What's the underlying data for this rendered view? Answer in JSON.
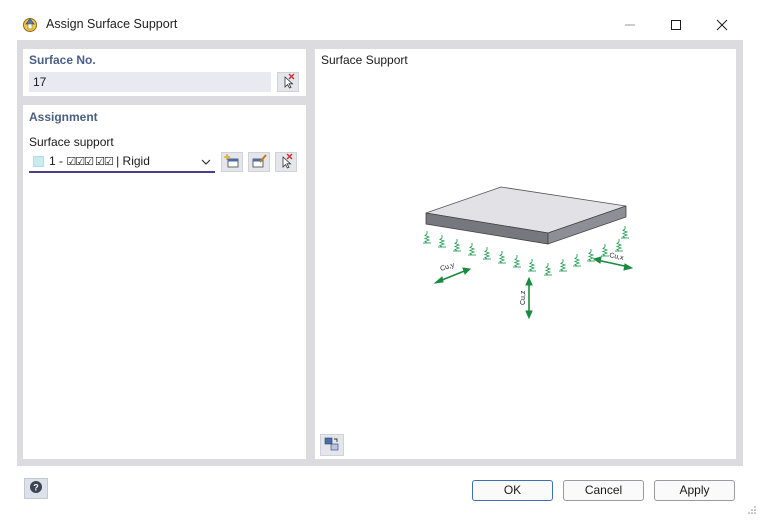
{
  "window": {
    "title": "Assign Surface Support",
    "minimize_icon": "minimize-icon",
    "maximize_icon": "maximize-icon",
    "close_icon": "close-icon"
  },
  "surface_no": {
    "heading": "Surface No.",
    "value": "17",
    "pick_icon": "pick-cursor-icon"
  },
  "assignment": {
    "heading": "Assignment",
    "support_label": "Surface support",
    "support_number": "1 -",
    "support_flags": "☑☑☑  ☑☑",
    "support_name": "| Rigid",
    "swatch_color": "#c9ecf1",
    "buttons": [
      "new-icon",
      "edit-icon",
      "pick-cursor-icon"
    ]
  },
  "preview": {
    "heading": "Surface Support",
    "labels": {
      "cy": "Cu,y",
      "cz": "Cu,z",
      "cx": "Cu,x"
    },
    "spring_color": "#2aa05a",
    "plate_top_color": "#e2e2e6",
    "plate_side_color": "#777780"
  },
  "footer": {
    "ok": "OK",
    "cancel": "Cancel",
    "apply": "Apply",
    "help_icon": "help-icon"
  }
}
